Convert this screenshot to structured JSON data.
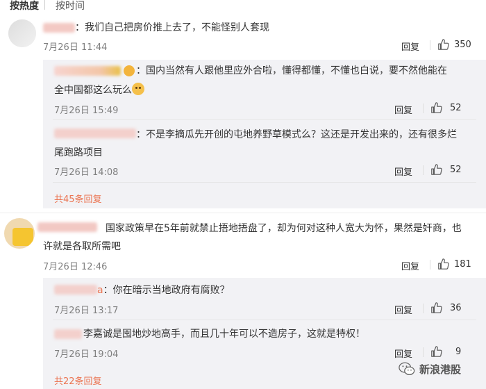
{
  "sort": {
    "hot_label": "按热度",
    "time_label": "按时间"
  },
  "comments": [
    {
      "text": "：我们自己把房价推上去了，不能怪别人套现",
      "time": "7月26日 11:44",
      "reply_label": "回复",
      "likes": "350",
      "replies": [
        {
          "text_line1": "：国内当然有人跟他里应外合啦，懂得都懂，不懂也白说，要不然他能在",
          "text_line2": "全中国都这么玩么",
          "time": "7月26日 15:49",
          "reply_label": "回复",
          "likes": "52"
        },
        {
          "text_line1": "：不是李摘瓜先开创的屯地养野草模式么？这还是开发出来的，还有很多烂",
          "text_line2": "尾跑路项目",
          "time": "7月26日 14:08",
          "reply_label": "回复",
          "likes": "52"
        }
      ],
      "more_label": "共45条回复"
    },
    {
      "text_line1": "国家政策早在5年前就禁止捂地捂盘了，却为何对这种人宽大为怀，果然是奸商，也",
      "text_line2": "许就是各取所需吧",
      "time": "7月26日 12:46",
      "reply_label": "回复",
      "likes": "181",
      "replies": [
        {
          "name_suffix": "a",
          "text": "：你在暗示当地政府有腐败？",
          "time": "7月26日 13:17",
          "reply_label": "回复",
          "likes": "36"
        },
        {
          "text": "李嘉诚是囤地炒地高手，而且几十年可以不造房子，这就是特权！",
          "time": "7月26日 19:04",
          "reply_label": "回复",
          "likes": "9"
        }
      ],
      "more_label": "共22条回复"
    }
  ],
  "watermark": {
    "text": "新浪港股",
    "icon": "wechat-icon"
  },
  "colors": {
    "link": "#eb7350",
    "sub_bg": "#f2f2f5",
    "meta": "#808080"
  }
}
